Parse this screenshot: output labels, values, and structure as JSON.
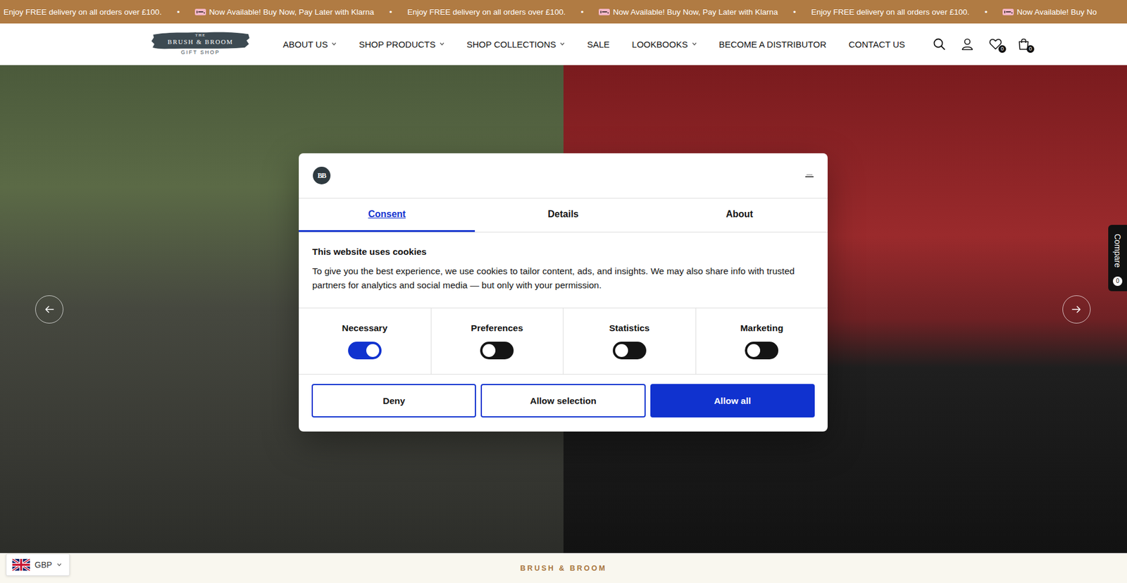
{
  "announcement": {
    "separator": "•",
    "items": [
      {
        "text": "Enjoy FREE delivery on all orders over £100.",
        "klarna": false
      },
      {
        "text": "Now Available! Buy Now, Pay Later with Klarna",
        "klarna": true
      },
      {
        "text": "Enjoy FREE delivery on all orders over £100.",
        "klarna": false
      },
      {
        "text": "Now Available! Buy Now, Pay Later with Klarna",
        "klarna": true
      },
      {
        "text": "Enjoy FREE delivery on all orders over £100.",
        "klarna": false
      },
      {
        "text": "Now Available! Buy No",
        "klarna": true
      }
    ]
  },
  "header": {
    "logo": {
      "top": "THE",
      "main": "BRUSH & BROOM",
      "sub": "GIFT SHOP"
    },
    "nav": [
      {
        "label": "ABOUT US",
        "dropdown": true
      },
      {
        "label": "SHOP PRODUCTS",
        "dropdown": true
      },
      {
        "label": "SHOP COLLECTIONS",
        "dropdown": true
      },
      {
        "label": "SALE",
        "dropdown": false
      },
      {
        "label": "LOOKBOOKS",
        "dropdown": true
      },
      {
        "label": "BECOME A DISTRIBUTOR",
        "dropdown": false
      },
      {
        "label": "CONTACT US",
        "dropdown": false
      }
    ],
    "wishlist_count": "0",
    "cart_count": "0"
  },
  "compare": {
    "label": "Compare",
    "count": "0"
  },
  "cookie_dialog": {
    "logo_text": "BB",
    "tabs": [
      {
        "label": "Consent",
        "selected": true
      },
      {
        "label": "Details",
        "selected": false
      },
      {
        "label": "About",
        "selected": false
      }
    ],
    "title": "This website uses cookies",
    "text": "To give you the best experience, we use cookies to tailor content, ads, and insights. We may also share info with trusted partners for analytics and social media — but only with your permission.",
    "categories": [
      {
        "label": "Necessary",
        "checked": true
      },
      {
        "label": "Preferences",
        "checked": false
      },
      {
        "label": "Statistics",
        "checked": false
      },
      {
        "label": "Marketing",
        "checked": false
      }
    ],
    "buttons": [
      {
        "label": "Deny",
        "primary": false
      },
      {
        "label": "Allow selection",
        "primary": false
      },
      {
        "label": "Allow all",
        "primary": true
      }
    ]
  },
  "currency": {
    "code": "GBP"
  },
  "footer_strip": {
    "label": "BRUSH & BROOM"
  }
}
